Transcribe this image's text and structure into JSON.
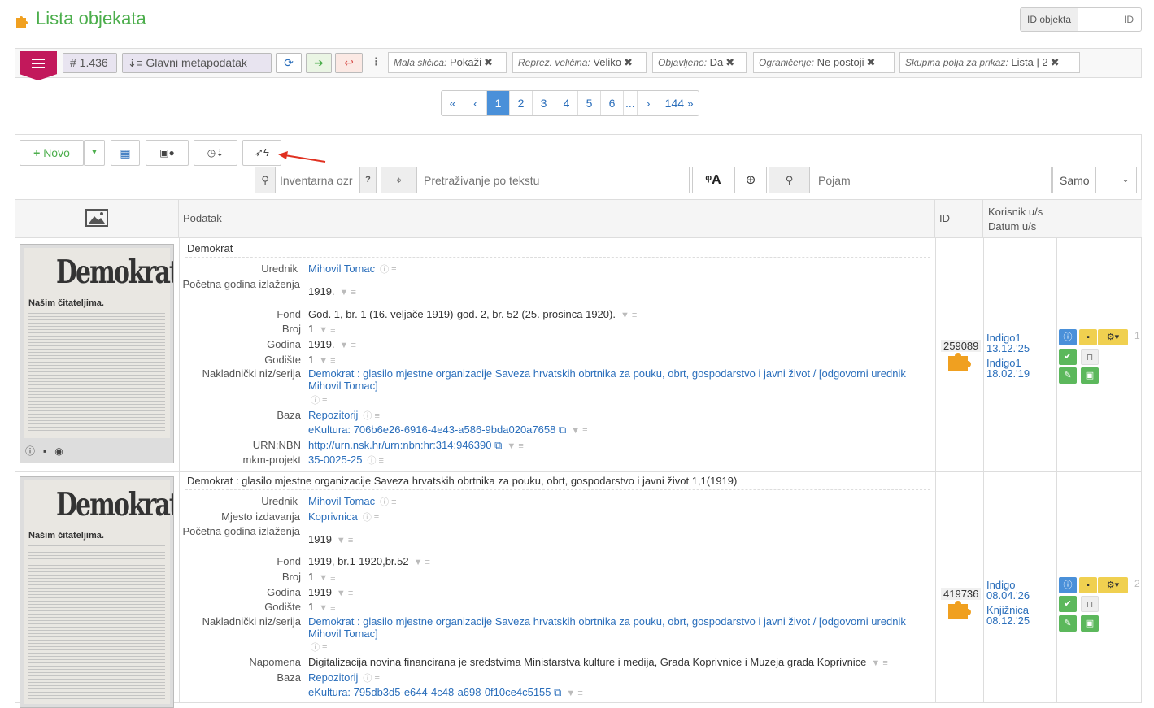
{
  "header": {
    "title": "Lista objekata",
    "id_label": "ID objekta",
    "id_placeholder": "ID"
  },
  "toolbar": {
    "count": "# 1.436",
    "meta": "Glavni metapodatak",
    "filters": [
      {
        "key": "Mala sličica:",
        "value": "Pokaži"
      },
      {
        "key": "Reprez. veličina:",
        "value": "Veliko"
      },
      {
        "key": "Objavljeno:",
        "value": "Da"
      },
      {
        "key": "Ograničenje:",
        "value": "Ne postoji"
      },
      {
        "key": "Skupina polja za prikaz:",
        "value": "Lista | 2"
      }
    ]
  },
  "pager": {
    "pages": [
      "1",
      "2",
      "3",
      "4",
      "5",
      "6",
      "...",
      "144"
    ],
    "current": "1"
  },
  "actions": {
    "new_label": "Novo"
  },
  "search": {
    "inventory_placeholder": "Inventarna ozr",
    "help": "?",
    "text_placeholder": "Pretraživanje po tekstu",
    "term_placeholder": "Pojam",
    "select_value": "Samo"
  },
  "table": {
    "col_data": "Podatak",
    "col_id": "ID",
    "col_user1": "Korisnik u/s",
    "col_user2": "Datum u/s"
  },
  "rows": [
    {
      "title": "Demokrat",
      "id": "259089",
      "num": "1",
      "users": [
        {
          "name": "Indigo1",
          "date": "13.12.'25"
        },
        {
          "name": "Indigo1",
          "date": "18.02.'19"
        }
      ],
      "fields": {
        "urednik": "Mihovil Tomac",
        "godina_label": "Početna godina izlaženja",
        "godina": "1919.",
        "fond": "God. 1, br. 1 (16. veljače 1919)-god. 2, br. 52 (25. prosinca 1920).",
        "broj": "1",
        "godina2": "1919.",
        "godiste": "1",
        "niz": "Demokrat : glasilo mjestne organizacije Saveza hrvatskih obrtnika za pouku, obrt, gospodarstvo i javni život / [odgovorni urednik Mihovil Tomac]",
        "baza": "Repozitorij",
        "ekultura": "eKultura: 706b6e26-6916-4e43-a586-9bda020a7658",
        "urn": "http://urn.nsk.hr/urn:nbn:hr:314:946390",
        "mkm": "35-0025-25"
      }
    },
    {
      "title": "Demokrat : glasilo mjestne organizacije Saveza hrvatskih obrtnika za pouku, obrt, gospodarstvo i javni život 1,1(1919)",
      "id": "419736",
      "num": "2",
      "users": [
        {
          "name": "Indigo",
          "date": "08.04.'26"
        },
        {
          "name": "Knjižnica",
          "date": "08.12.'25"
        }
      ],
      "fields": {
        "urednik": "Mihovil Tomac",
        "mjesto": "Koprivnica",
        "godina": "1919",
        "fond": "1919, br.1-1920,br.52",
        "broj": "1",
        "godina2": "1919",
        "godiste": "1",
        "niz": "Demokrat : glasilo mjestne organizacije Saveza hrvatskih obrtnika za pouku, obrt, gospodarstvo i javni život / [odgovorni urednik Mihovil Tomac]",
        "napomena": "Digitalizacija novina financirana je sredstvima Ministarstva kulture i medija, Grada Koprivnice i Muzeja grada Koprivnice",
        "baza": "Repozitorij",
        "ekultura": "eKultura: 795db3d5-e644-4c48-a698-0f10ce4c5155"
      }
    }
  ],
  "labels": {
    "urednik": "Urednik",
    "godina": "Početna godina izlaženja",
    "fond": "Fond",
    "broj": "Broj",
    "godina2": "Godina",
    "godiste": "Godište",
    "niz": "Nakladnički niz/serija",
    "baza": "Baza",
    "urn": "URN:NBN",
    "mkm": "mkm-projekt",
    "mjesto": "Mjesto izdavanja",
    "napomena": "Napomena"
  },
  "thumb": {
    "masthead": "Demokrat",
    "subhead": "Našim čitateljima."
  }
}
